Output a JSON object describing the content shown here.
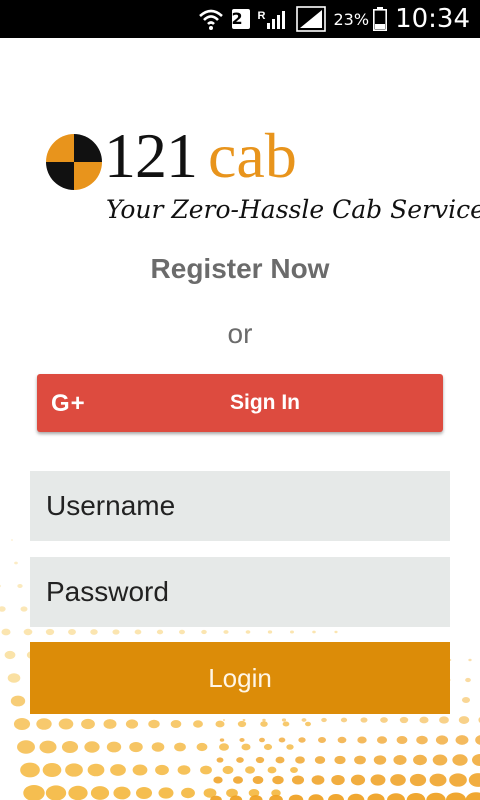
{
  "status_bar": {
    "sim_slot": "2",
    "roaming": "R",
    "battery": "23%",
    "time": "10:34",
    "icons": [
      "wifi-icon",
      "sim-badge",
      "signal-roaming-icon",
      "signal-icon",
      "battery-icon"
    ]
  },
  "logo": {
    "number": "121",
    "word": "cab",
    "tagline": "Your Zero-Hassle Cab Services"
  },
  "register_label": "Register Now",
  "or_label": "or",
  "google_signin": {
    "icon_text": "G+",
    "label": "Sign In"
  },
  "form": {
    "username_placeholder": "Username",
    "password_placeholder": "Password",
    "login_label": "Login"
  },
  "colors": {
    "brand_orange": "#e8941c",
    "google_red": "#dd4b3f",
    "login_orange": "#dc8c08",
    "field_bg": "#e6e9e8",
    "muted_text": "#6b6b6b"
  }
}
